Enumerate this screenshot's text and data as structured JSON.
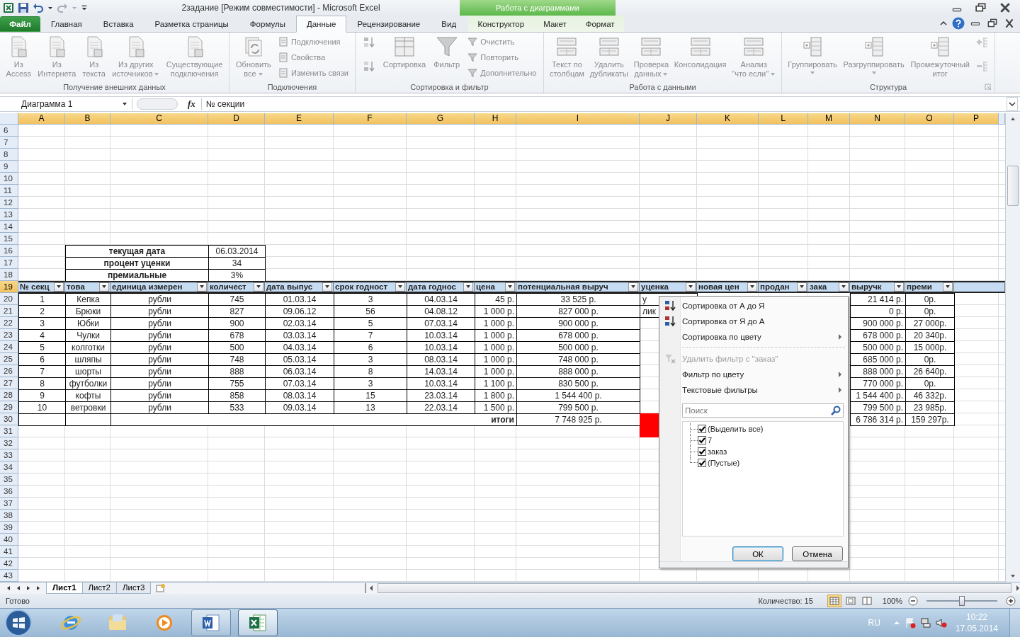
{
  "window": {
    "title": "2задание  [Режим совместимости]  -  Microsoft Excel"
  },
  "ribbon_tabs": [
    {
      "label": "Файл",
      "kind": "file",
      "selected": false
    },
    {
      "label": "Главная",
      "kind": "tab",
      "selected": false
    },
    {
      "label": "Вставка",
      "kind": "tab",
      "selected": false
    },
    {
      "label": "Разметка страницы",
      "kind": "tab",
      "selected": false
    },
    {
      "label": "Формулы",
      "kind": "tab",
      "selected": false
    },
    {
      "label": "Данные",
      "kind": "tab",
      "selected": true
    },
    {
      "label": "Рецензирование",
      "kind": "tab",
      "selected": false
    },
    {
      "label": "Вид",
      "kind": "tab",
      "selected": false
    }
  ],
  "contextual_tabs": {
    "label": "Работа с диаграммами",
    "tabs": [
      {
        "label": "Конструктор",
        "selected": false
      },
      {
        "label": "Макет",
        "selected": false
      },
      {
        "label": "Формат",
        "selected": false
      }
    ]
  },
  "ribbon_groups": [
    {
      "label": "Получение внешних данных",
      "launcher": false,
      "buttons": [
        {
          "label": "Из\nAccess",
          "kind": "large",
          "has_menu": false,
          "disabled": true
        },
        {
          "label": "Из\nИнтернета",
          "kind": "large",
          "has_menu": false,
          "disabled": true
        },
        {
          "label": "Из\nтекста",
          "kind": "large",
          "has_menu": false,
          "disabled": true
        },
        {
          "label": "Из других\nисточников",
          "kind": "large",
          "has_menu": true,
          "disabled": true
        },
        {
          "label": "Существующие\nподключения",
          "kind": "large",
          "has_menu": false,
          "disabled": true
        }
      ]
    },
    {
      "label": "Подключения",
      "launcher": false,
      "buttons": [
        {
          "label": "Обновить\nвсе",
          "kind": "large",
          "has_menu": true,
          "disabled": true
        },
        {
          "label": "Подключения",
          "kind": "small",
          "has_menu": false,
          "disabled": true
        },
        {
          "label": "Свойства",
          "kind": "small",
          "has_menu": false,
          "disabled": true
        },
        {
          "label": "Изменить связи",
          "kind": "small",
          "has_menu": false,
          "disabled": true
        }
      ]
    },
    {
      "label": "Сортировка и фильтр",
      "launcher": false,
      "buttons": [
        {
          "kind": "sort_asc",
          "has_menu": false,
          "disabled": true
        },
        {
          "kind": "sort_desc",
          "has_menu": false,
          "disabled": true
        },
        {
          "label": "Сортировка",
          "kind": "large",
          "has_menu": false,
          "disabled": true
        },
        {
          "label": "Фильтр",
          "kind": "large",
          "has_menu": false,
          "disabled": true
        },
        {
          "label": "Очистить",
          "kind": "small",
          "has_menu": false,
          "disabled": true
        },
        {
          "label": "Повторить",
          "kind": "small",
          "has_menu": false,
          "disabled": true
        },
        {
          "label": "Дополнительно",
          "kind": "small",
          "has_menu": false,
          "disabled": true
        }
      ]
    },
    {
      "label": "Работа с данными",
      "launcher": false,
      "buttons": [
        {
          "label": "Текст по\nстолбцам",
          "kind": "large",
          "has_menu": false,
          "disabled": true
        },
        {
          "label": "Удалить\nдубликаты",
          "kind": "large",
          "has_menu": false,
          "disabled": true
        },
        {
          "label": "Проверка\nданных",
          "kind": "large",
          "has_menu": true,
          "disabled": true
        },
        {
          "label": "Консолидация",
          "kind": "large",
          "has_menu": false,
          "disabled": true
        },
        {
          "label": "Анализ\n\"что если\"",
          "kind": "large",
          "has_menu": true,
          "disabled": true
        }
      ]
    },
    {
      "label": "Структура",
      "launcher": true,
      "buttons": [
        {
          "label": "Группировать",
          "kind": "large",
          "has_menu": true,
          "disabled": true
        },
        {
          "label": "Разгруппировать",
          "kind": "large",
          "has_menu": true,
          "disabled": true
        },
        {
          "label": "Промежуточный\nитог",
          "kind": "large",
          "has_menu": false,
          "disabled": true
        },
        {
          "kind": "show_detail",
          "has_menu": false,
          "disabled": true
        },
        {
          "kind": "hide_detail",
          "has_menu": false,
          "disabled": true
        }
      ]
    }
  ],
  "formula_bar": {
    "name_box": "Диаграмма 1",
    "function_label": "fx",
    "content": "№ секции"
  },
  "sheet": {
    "columns": [
      {
        "label": "A",
        "selected": true
      },
      {
        "label": "B",
        "selected": true
      },
      {
        "label": "C",
        "selected": true
      },
      {
        "label": "D",
        "selected": true
      },
      {
        "label": "E",
        "selected": true
      },
      {
        "label": "F",
        "selected": true
      },
      {
        "label": "G",
        "selected": true
      },
      {
        "label": "H",
        "selected": true
      },
      {
        "label": "I",
        "selected": true
      },
      {
        "label": "J",
        "selected": true
      },
      {
        "label": "K",
        "selected": true
      },
      {
        "label": "L",
        "selected": true
      },
      {
        "label": "M",
        "selected": true
      },
      {
        "label": "N",
        "selected": true
      },
      {
        "label": "O",
        "selected": true
      },
      {
        "label": "P",
        "selected": true
      }
    ],
    "rows": [
      {
        "label": "6",
        "selected": false
      },
      {
        "label": "7",
        "selected": false
      },
      {
        "label": "8",
        "selected": false
      },
      {
        "label": "9",
        "selected": false
      },
      {
        "label": "10",
        "selected": false
      },
      {
        "label": "11",
        "selected": false
      },
      {
        "label": "12",
        "selected": false
      },
      {
        "label": "13",
        "selected": false
      },
      {
        "label": "14",
        "selected": false
      },
      {
        "label": "15",
        "selected": false
      },
      {
        "label": "16",
        "selected": false
      },
      {
        "label": "17",
        "selected": false
      },
      {
        "label": "18",
        "selected": false
      },
      {
        "label": "19",
        "selected": true
      },
      {
        "label": "20",
        "selected": false
      },
      {
        "label": "21",
        "selected": false
      },
      {
        "label": "22",
        "selected": false
      },
      {
        "label": "23",
        "selected": false
      },
      {
        "label": "24",
        "selected": false
      },
      {
        "label": "25",
        "selected": false
      },
      {
        "label": "26",
        "selected": false
      },
      {
        "label": "27",
        "selected": false
      },
      {
        "label": "28",
        "selected": false
      },
      {
        "label": "29",
        "selected": false
      },
      {
        "label": "30",
        "selected": false
      },
      {
        "label": "31",
        "selected": false
      },
      {
        "label": "32",
        "selected": false
      },
      {
        "label": "33",
        "selected": false
      },
      {
        "label": "34",
        "selected": false
      },
      {
        "label": "35",
        "selected": false
      },
      {
        "label": "36",
        "selected": false
      },
      {
        "label": "37",
        "selected": false
      },
      {
        "label": "38",
        "selected": false
      },
      {
        "label": "39",
        "selected": false
      },
      {
        "label": "40",
        "selected": false
      },
      {
        "label": "41",
        "selected": false
      },
      {
        "label": "42",
        "selected": false
      },
      {
        "label": "43",
        "selected": false
      }
    ]
  },
  "info_table": [
    {
      "label": "текущая дата",
      "value": "06.03.2014"
    },
    {
      "label": "процент уценки",
      "value": "34"
    },
    {
      "label": "премиальные",
      "value": "3%"
    }
  ],
  "table": {
    "headers": [
      "№ секц",
      "това",
      "единица измерен",
      "количест",
      "дата выпус",
      "срок годност",
      "дата годнос",
      "цена",
      "потенциальная выруч",
      "уценка",
      "новая цен",
      "продан",
      "зака",
      "выручк",
      "преми"
    ],
    "rows": [
      {
        "A": "1",
        "B": "Кепка",
        "C": "рубли",
        "D": "745",
        "E": "01.03.14",
        "F": "3",
        "G": "04.03.14",
        "H": "45 р.",
        "I": "33 525 р.",
        "J": "у",
        "N": "21 414 р.",
        "O": "0р."
      },
      {
        "A": "2",
        "B": "Брюки",
        "C": "рубли",
        "D": "827",
        "E": "09.06.12",
        "F": "56",
        "G": "04.08.12",
        "H": "1 000 р.",
        "I": "827 000 р.",
        "J": "лик",
        "N": "0 р.",
        "O": "0р."
      },
      {
        "A": "3",
        "B": "Юбки",
        "C": "рубли",
        "D": "900",
        "E": "02.03.14",
        "F": "5",
        "G": "07.03.14",
        "H": "1 000 р.",
        "I": "900 000 р.",
        "N": "900 000 р.",
        "O": "27 000р."
      },
      {
        "A": "4",
        "B": "Чулки",
        "C": "рубли",
        "D": "678",
        "E": "03.03.14",
        "F": "7",
        "G": "10.03.14",
        "H": "1 000 р.",
        "I": "678 000 р.",
        "N": "678 000 р.",
        "O": "20 340р."
      },
      {
        "A": "5",
        "B": "колготки",
        "C": "рубли",
        "D": "500",
        "E": "04.03.14",
        "F": "6",
        "G": "10.03.14",
        "H": "1 000 р.",
        "I": "500 000 р.",
        "N": "500 000 р.",
        "O": "15 000р."
      },
      {
        "A": "6",
        "B": "шляпы",
        "C": "рубли",
        "D": "748",
        "E": "05.03.14",
        "F": "3",
        "G": "08.03.14",
        "H": "1 000 р.",
        "I": "748 000 р.",
        "N": "685 000 р.",
        "O": "0р."
      },
      {
        "A": "7",
        "B": "шорты",
        "C": "рубли",
        "D": "888",
        "E": "06.03.14",
        "F": "8",
        "G": "14.03.14",
        "H": "1 000 р.",
        "I": "888 000 р.",
        "N": "888 000 р.",
        "O": "26 640р."
      },
      {
        "A": "8",
        "B": "футболки",
        "C": "рубли",
        "D": "755",
        "E": "07.03.14",
        "F": "3",
        "G": "10.03.14",
        "H": "1 100 р.",
        "I": "830 500 р.",
        "N": "770 000 р.",
        "O": "0р."
      },
      {
        "A": "9",
        "B": "кофты",
        "C": "рубли",
        "D": "858",
        "E": "08.03.14",
        "F": "15",
        "G": "23.03.14",
        "H": "1 800 р.",
        "I": "1 544 400 р.",
        "N": "1 544 400 р.",
        "O": "46 332р."
      },
      {
        "A": "10",
        "B": "ветровки",
        "C": "рубли",
        "D": "533",
        "E": "09.03.14",
        "F": "13",
        "G": "22.03.14",
        "H": "1 500 р.",
        "I": "799 500 р.",
        "N": "799 500 р.",
        "O": "23 985р."
      }
    ],
    "totals": {
      "label": "итоги",
      "I": "7 748 925 р.",
      "N": "6 786 314 р.",
      "O": "159 297р.",
      "highlight": {
        "color": "#ff0000"
      }
    }
  },
  "filter_menu": {
    "items": [
      {
        "label": "Сортировка от А до Я",
        "kind": "sort_asc",
        "disabled": false,
        "submenu": false
      },
      {
        "label": "Сортировка от Я до А",
        "kind": "sort_desc",
        "disabled": false,
        "submenu": false
      },
      {
        "label": "Сортировка по цвету",
        "kind": "plain",
        "disabled": false,
        "submenu": true
      },
      {
        "kind": "separator"
      },
      {
        "label": "Удалить фильтр с \"заказ\"",
        "kind": "clear",
        "disabled": true,
        "submenu": false
      },
      {
        "label": "Фильтр по цвету",
        "kind": "plain",
        "disabled": false,
        "submenu": true
      },
      {
        "label": "Текстовые фильтры",
        "kind": "plain",
        "disabled": false,
        "submenu": true
      }
    ],
    "search": {
      "placeholder": "Поиск"
    },
    "values": [
      {
        "label": "(Выделить все)",
        "checked": true
      },
      {
        "label": "7",
        "checked": true
      },
      {
        "label": "заказ",
        "checked": true
      },
      {
        "label": "(Пустые)",
        "checked": true
      }
    ],
    "buttons": [
      {
        "label": "ОК",
        "default": true
      },
      {
        "label": "Отмена",
        "default": false
      }
    ]
  },
  "sheet_tabs": [
    {
      "label": "Лист1",
      "selected": true
    },
    {
      "label": "Лист2",
      "selected": false
    },
    {
      "label": "Лист3",
      "selected": false
    }
  ],
  "status_bar": {
    "ready": "Готово",
    "count": "Количество: 15",
    "views": [
      {
        "selected": true
      },
      {
        "selected": false
      },
      {
        "selected": false
      }
    ],
    "zoom": "100%",
    "zoom_slider": {
      "level": 0.5
    }
  },
  "taskbar": {
    "apps": [
      {
        "open": false,
        "selected": false
      },
      {
        "open": false,
        "selected": false
      },
      {
        "open": false,
        "selected": false
      },
      {
        "open": true,
        "selected": false
      },
      {
        "open": true,
        "selected": true
      }
    ],
    "language": "RU",
    "time": "10:22",
    "date": "17.05.2014"
  }
}
